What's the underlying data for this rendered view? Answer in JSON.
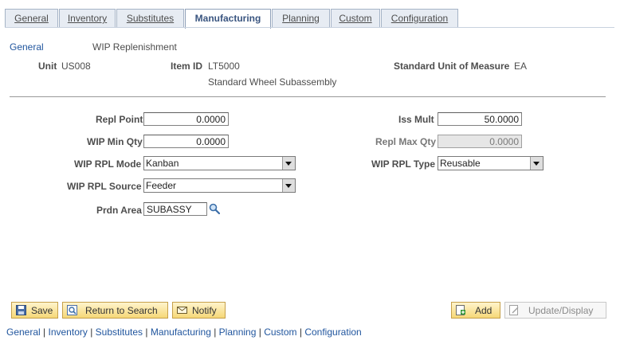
{
  "tabs": [
    {
      "label": "General"
    },
    {
      "label": "Inventory"
    },
    {
      "label": "Substitutes"
    },
    {
      "label": "Manufacturing"
    },
    {
      "label": "Planning"
    },
    {
      "label": "Custom"
    },
    {
      "label": "Configuration"
    }
  ],
  "breadcrumb": {
    "link": "General",
    "title": "WIP Replenishment"
  },
  "header": {
    "unit_label": "Unit",
    "unit_value": "US008",
    "item_label": "Item ID",
    "item_value": "LT5000",
    "item_desc": "Standard Wheel Subassembly",
    "uom_label": "Standard Unit of Measure",
    "uom_value": "EA"
  },
  "form": {
    "repl_point_label": "Repl Point",
    "repl_point_value": "0.0000",
    "wip_min_label": "WIP Min Qty",
    "wip_min_value": "0.0000",
    "wip_mode_label": "WIP RPL Mode",
    "wip_mode_value": "Kanban",
    "wip_source_label": "WIP RPL Source",
    "wip_source_value": "Feeder",
    "prdn_area_label": "Prdn Area",
    "prdn_area_value": "SUBASSY",
    "iss_mult_label": "Iss Mult",
    "iss_mult_value": "50.0000",
    "repl_max_label": "Repl Max Qty",
    "repl_max_value": "0.0000",
    "wip_type_label": "WIP RPL Type",
    "wip_type_value": "Reusable"
  },
  "toolbar": {
    "save_label": "Save",
    "return_label": "Return to Search",
    "notify_label": "Notify",
    "add_label": "Add",
    "update_label": "Update/Display"
  },
  "footer_links": [
    "General",
    "Inventory",
    "Substitutes",
    "Manufacturing",
    "Planning",
    "Custom",
    "Configuration"
  ],
  "colors": {
    "link": "#21569e",
    "button_bg": "#f6d878",
    "tab_active_text": "#3a5580"
  }
}
